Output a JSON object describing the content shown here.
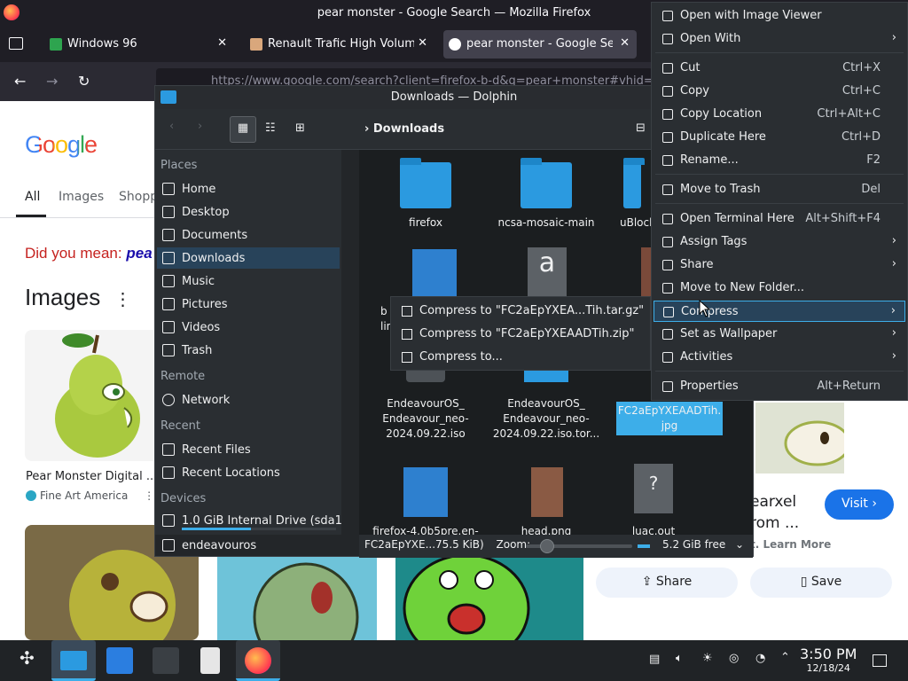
{
  "firefox": {
    "window_title": "pear monster - Google Search — Mozilla Firefox",
    "tabs": [
      {
        "label": "Windows 96"
      },
      {
        "label": "Renault Trafic High Volum"
      },
      {
        "label": "pear monster - Google Se"
      }
    ],
    "url": "https://www.google.com/search?client=firefox-b-d&q=pear+monster#vhid="
  },
  "google": {
    "logo": "Google",
    "tabs": [
      "All",
      "Images",
      "Shopp"
    ],
    "did_you_mean": "Did you mean:",
    "did_you_mean_link": "pea",
    "images_heading": "Images",
    "result1_title": "Pear Monster Digital ...",
    "result1_source": "Fine Art America",
    "side_title_1": "earxel",
    "side_title_2": "rom ...",
    "side_learn": "t. Learn More",
    "visit": "Visit",
    "share": "Share",
    "save": "Save"
  },
  "dolphin": {
    "title": "Downloads — Dolphin",
    "breadcrumb": "Downloads",
    "places_header": "Places",
    "places": [
      "Home",
      "Desktop",
      "Documents",
      "Downloads",
      "Music",
      "Pictures",
      "Videos",
      "Trash"
    ],
    "remote_header": "Remote",
    "remote": [
      "Network"
    ],
    "recent_header": "Recent",
    "recent": [
      "Recent Files",
      "Recent Locations"
    ],
    "devices_header": "Devices",
    "devices": [
      "1.0 GiB Internal Drive (sda1)",
      "endeavouros"
    ],
    "files": [
      {
        "name": "firefox"
      },
      {
        "name": "ncsa-mosaic-main"
      },
      {
        "name": "uBlock"
      },
      {
        "name": "b\nlinu"
      },
      {
        "name": "EndeavourOS_\nEndeavour_neo-\n2024.09.22.iso"
      },
      {
        "name": "EndeavourOS_\nEndeavour_neo-\n2024.09.22.iso.tor..."
      },
      {
        "name": "FC2aEpYXEAADTih.\njpg"
      },
      {
        "name": "firefox-4.0b5pre.en-"
      },
      {
        "name": "head.png"
      },
      {
        "name": "luac.out"
      }
    ],
    "status_file": "FC2aEpYXE...75.5 KiB)",
    "zoom_label": "Zoom:",
    "free_space": "5.2 GiB free",
    "zoom_level": 0.2,
    "disk_used_fraction": 0.45
  },
  "context_menu": {
    "items": [
      {
        "label": "Open with Image Viewer",
        "shortcut": ""
      },
      {
        "label": "Open With",
        "shortcut": "",
        "submenu": true
      },
      {
        "label": "Cut",
        "shortcut": "Ctrl+X"
      },
      {
        "label": "Copy",
        "shortcut": "Ctrl+C"
      },
      {
        "label": "Copy Location",
        "shortcut": "Ctrl+Alt+C"
      },
      {
        "label": "Duplicate Here",
        "shortcut": "Ctrl+D"
      },
      {
        "label": "Rename...",
        "shortcut": "F2"
      },
      {
        "label": "Move to Trash",
        "shortcut": "Del"
      },
      {
        "label": "Open Terminal Here",
        "shortcut": "Alt+Shift+F4"
      },
      {
        "label": "Assign Tags",
        "shortcut": "",
        "submenu": true
      },
      {
        "label": "Share",
        "shortcut": "",
        "submenu": true
      },
      {
        "label": "Move to New Folder...",
        "shortcut": ""
      },
      {
        "label": "Compress",
        "shortcut": "",
        "submenu": true
      },
      {
        "label": "Set as Wallpaper",
        "shortcut": "",
        "submenu": true
      },
      {
        "label": "Activities",
        "shortcut": "",
        "submenu": true
      },
      {
        "label": "Properties",
        "shortcut": "Alt+Return"
      }
    ]
  },
  "compress_submenu": {
    "items": [
      "Compress to \"FC2aEpYXEA...Tih.tar.gz\"",
      "Compress to \"FC2aEpYXEAADTih.zip\"",
      "Compress to..."
    ]
  },
  "taskbar": {
    "time": "3:50 PM",
    "date": "12/18/24"
  },
  "colors": {
    "kde_accent": "#3daee9",
    "firefox_chrome": "#1f1e25",
    "google_blue": "#1a73e8"
  }
}
